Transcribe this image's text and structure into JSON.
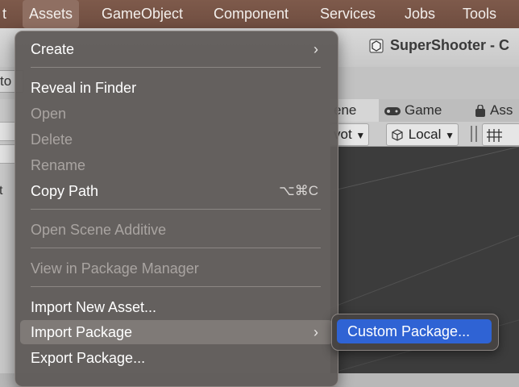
{
  "menubar": {
    "items": [
      "t",
      "Assets",
      "GameObject",
      "Component",
      "Services",
      "Jobs",
      "Tools"
    ],
    "active": "Assets"
  },
  "window": {
    "title": "SuperShooter - C",
    "left_stub": "to",
    "left_panel_stub": "t"
  },
  "tabs": {
    "scene_partial": "ene",
    "game": "Game",
    "asset_store_partial": "Ass"
  },
  "scene_toolbar": {
    "pivot_partial": "vot",
    "space": "Local",
    "dropdown_icon": "chevron-down-icon"
  },
  "menu": {
    "create": "Create",
    "reveal": "Reveal in Finder",
    "open": "Open",
    "delete": "Delete",
    "rename": "Rename",
    "copy_path": "Copy Path",
    "copy_path_shortcut": "⌥⌘C",
    "open_scene_additive": "Open Scene Additive",
    "view_in_package_manager": "View in Package Manager",
    "import_new_asset": "Import New Asset...",
    "import_package": "Import Package",
    "export_package": "Export Package..."
  },
  "submenu": {
    "custom_package": "Custom Package..."
  },
  "colors": {
    "menubar": "#7e5a4b",
    "menu_bg": "#605c5a",
    "submenu_highlight": "#2f63d4"
  }
}
